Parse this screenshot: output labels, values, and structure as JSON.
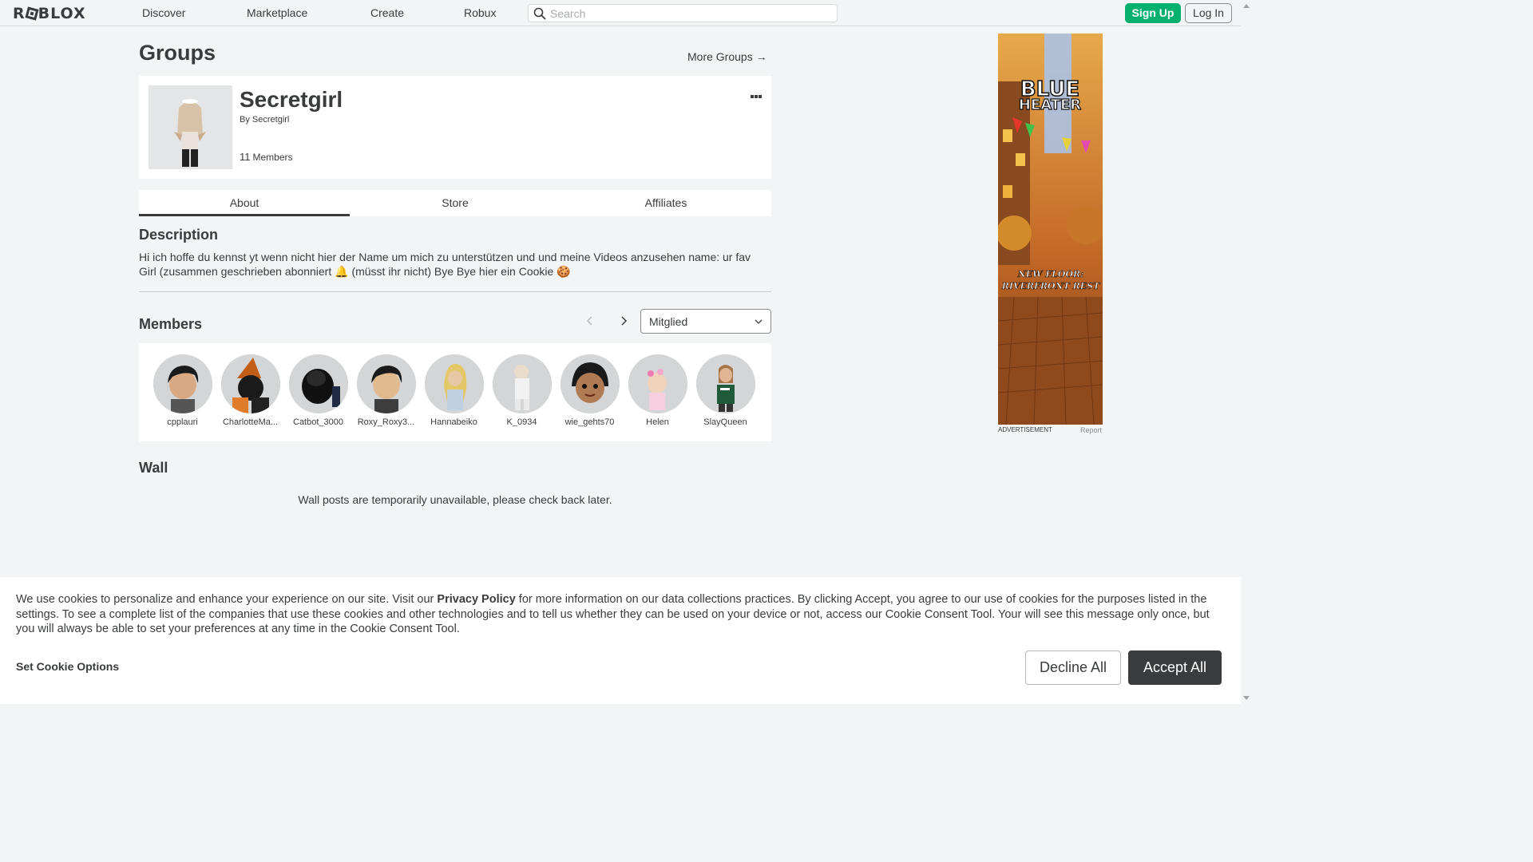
{
  "header": {
    "logo": "ROBLOX",
    "nav": [
      "Discover",
      "Marketplace",
      "Create",
      "Robux"
    ],
    "search_placeholder": "Search",
    "signup_label": "Sign Up",
    "login_label": "Log In"
  },
  "page": {
    "title": "Groups",
    "more_groups": "More Groups →"
  },
  "group": {
    "name": "Secretgirl",
    "by_label": "By",
    "owner": "Secretgirl",
    "member_count": "11",
    "members_label": "Members"
  },
  "tabs": [
    "About",
    "Store",
    "Affiliates"
  ],
  "description": {
    "title": "Description",
    "text": "Hi ich hoffe du kennst yt wenn nicht hier der Name um mich zu unterstützen und und meine Videos anzusehen name: ur fav Girl (zusammen geschrieben abonniert 🔔 (müsst ihr nicht) Bye Bye hier ein Cookie 🍪"
  },
  "members": {
    "title": "Members",
    "role_filter": "Mitglied",
    "list": [
      "cpplauri",
      "CharlotteMa...",
      "Catbot_3000",
      "Roxy_Roxy3...",
      "Hannabeiko",
      "K_0934",
      "wie_gehts70",
      "Helen",
      "SlayQueen"
    ]
  },
  "wall": {
    "title": "Wall",
    "message": "Wall posts are temporarily unavailable, please check back later."
  },
  "ad": {
    "headline_1": "BLUE",
    "headline_2": "HEATER",
    "tagline_1": "NEW FLOOR:",
    "tagline_2": "RIVERFRONT REST",
    "label": "ADVERTISEMENT",
    "report": "Report"
  },
  "cookie": {
    "text_before": "We use cookies to personalize and enhance your experience on our site. Visit our ",
    "privacy_link": "Privacy Policy",
    "text_after": " for more information on our data collections practices. By clicking Accept, you agree to our use of cookies for the purposes listed in the settings. To see a complete list of the companies that use these cookies and other technologies and to tell us whether they can be used on your device or not, access our Cookie Consent Tool. Your will see this message only once, but you will always be able to set your preferences at any time in the Cookie Consent Tool.",
    "options_label": "Set Cookie Options",
    "decline_label": "Decline All",
    "accept_label": "Accept All"
  }
}
